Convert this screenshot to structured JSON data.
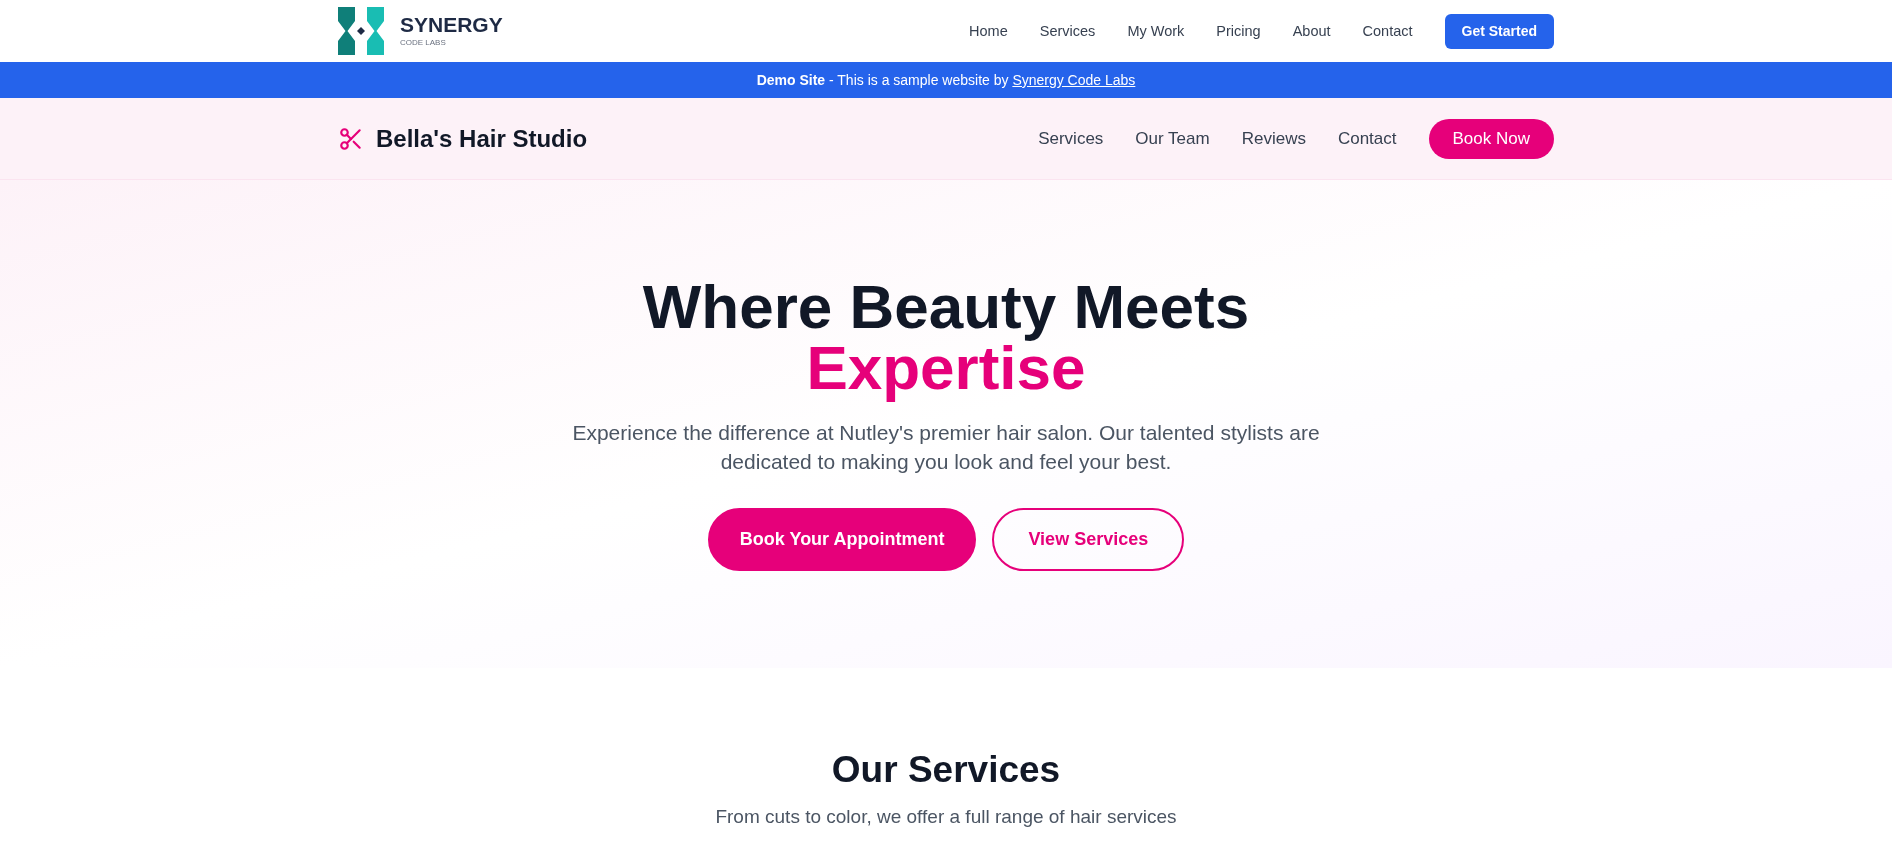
{
  "top_nav": {
    "logo": {
      "name": "SYNERGY",
      "tagline": "CODE LABS"
    },
    "links": [
      "Home",
      "Services",
      "My Work",
      "Pricing",
      "About",
      "Contact"
    ],
    "button": "Get Started"
  },
  "demo_banner": {
    "text": "**Demo Site** - This is a sample website by ",
    "link": "Synergy Code Labs"
  },
  "salon_header": {
    "name": "Bella's Hair Studio",
    "links": [
      "Services",
      "Our Team",
      "Reviews",
      "Contact"
    ],
    "button": "Book Now"
  },
  "hero": {
    "title": "Where Beauty Meets",
    "title_highlight": "Expertise",
    "subtitle": "Experience the difference at Nutley's premier hair salon. Our talented stylists are dedicated to making you look and feel your best.",
    "buttons": [
      {
        "label": "Book Your Appointment",
        "kind": "primary"
      },
      {
        "label": "View Services",
        "kind": "outline"
      }
    ]
  },
  "services": {
    "title": "Our Services",
    "subtitle": "From cuts to color, we offer a full range of hair services"
  }
}
